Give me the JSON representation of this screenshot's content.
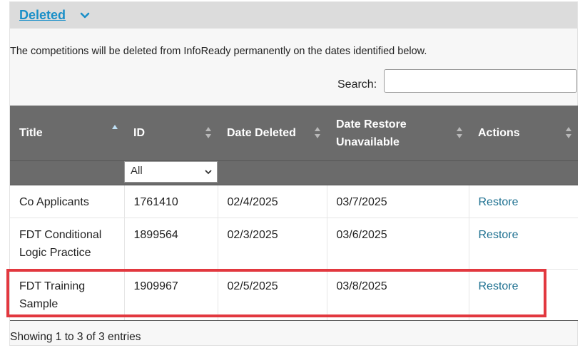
{
  "section": {
    "title": "Deleted",
    "toggle_icon": "chevron-down-icon"
  },
  "intro_text": "The competitions will be deleted from InfoReady permanently on the dates identified below.",
  "search": {
    "label": "Search:",
    "value": "",
    "placeholder": ""
  },
  "table": {
    "columns": [
      "Title",
      "ID",
      "Date Deleted",
      "Date Restore Unavailable",
      "Actions"
    ],
    "id_filter": "All",
    "rows": [
      {
        "title": "Co Applicants",
        "id": "1761410",
        "date_deleted": "02/4/2025",
        "restore_unavailable": "03/7/2025",
        "action": "Restore"
      },
      {
        "title": "FDT Conditional Logic Practice",
        "id": "1899564",
        "date_deleted": "02/3/2025",
        "restore_unavailable": "03/6/2025",
        "action": "Restore"
      },
      {
        "title": "FDT Training Sample",
        "id": "1909967",
        "date_deleted": "02/5/2025",
        "restore_unavailable": "03/8/2025",
        "action": "Restore"
      }
    ]
  },
  "footer": {
    "info": "Showing 1 to 3 of 3 entries"
  },
  "colors": {
    "link": "#1a8fc8",
    "header_bg": "#6b6b6b",
    "highlight": "#e2383f",
    "restore": "#1f7191"
  }
}
